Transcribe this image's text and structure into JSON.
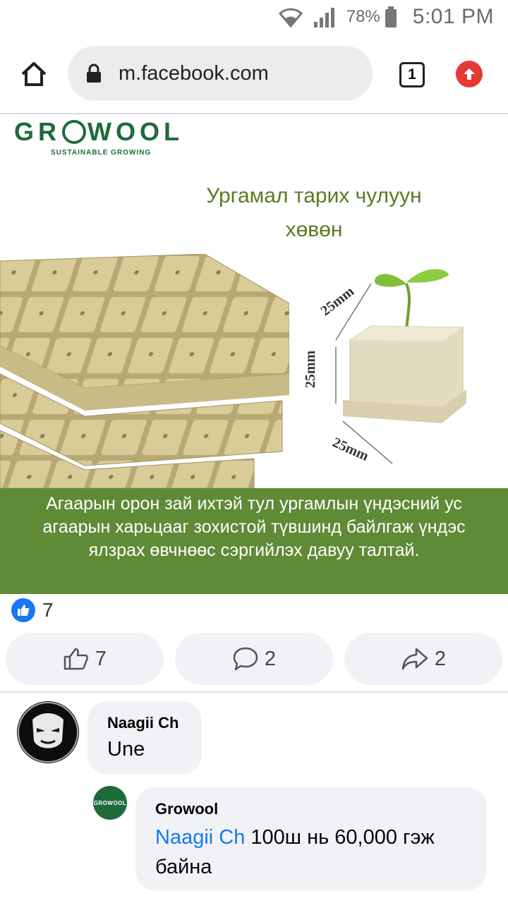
{
  "status_bar": {
    "battery": "78%",
    "time": "5:01 PM"
  },
  "browser": {
    "url": "m.facebook.com",
    "tab_count": "1"
  },
  "post": {
    "image": {
      "logo": {
        "left": "GR",
        "right": "WOOL",
        "tagline": "SUSTAINABLE GROWING"
      },
      "headline_line1": "Ургамал тарих чулуун",
      "headline_line2": "хөвөн",
      "dim_top": "25mm",
      "dim_side": "25mm",
      "dim_bottom": "25mm",
      "caption": "Агаарын орон зай ихтэй тул ургамлын үндэсний ус агаарын харьцааг зохистой түвшинд байлгаж үндэс ялзрах өвчнөөс сэргийлэх давуу талтай."
    },
    "reaction_count": "7",
    "actions": {
      "like_count": "7",
      "comment_count": "2",
      "share_count": "2"
    }
  },
  "comments": [
    {
      "author": "Naagii Ch",
      "text": "Une"
    },
    {
      "author": "Growool",
      "mention": "Naagii Ch",
      "text": " 100ш нь 60,000 гэж байна",
      "avatar_label": "GROWOOL"
    }
  ],
  "colors": {
    "brand_green": "#1e6b3a",
    "caption_band": "#5f8a36",
    "facebook_blue": "#1877f2",
    "upload_red": "#e53935"
  },
  "icons": [
    "wifi-icon",
    "signal-icon",
    "battery-icon",
    "home-icon",
    "lock-icon",
    "tab-switcher-icon",
    "upload-icon",
    "like-badge-icon",
    "like-icon",
    "comment-icon",
    "share-icon"
  ]
}
